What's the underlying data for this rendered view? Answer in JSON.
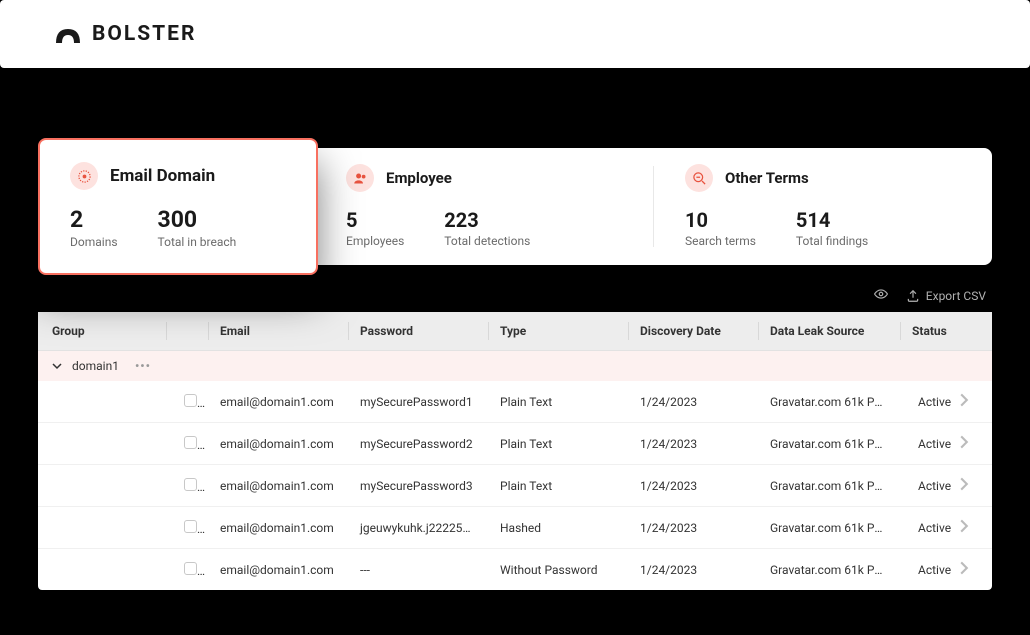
{
  "brand": {
    "name": "BOLSTER"
  },
  "cards": {
    "email_domain": {
      "title": "Email Domain",
      "stat1_value": "2",
      "stat1_label": "Domains",
      "stat2_value": "300",
      "stat2_label": "Total in breach"
    },
    "employee": {
      "title": "Employee",
      "stat1_value": "5",
      "stat1_label": "Employees",
      "stat2_value": "223",
      "stat2_label": "Total detections"
    },
    "other_terms": {
      "title": "Other Terms",
      "stat1_value": "10",
      "stat1_label": "Search terms",
      "stat2_value": "514",
      "stat2_label": "Total findings"
    }
  },
  "toolbar": {
    "export_label": "Export CSV"
  },
  "table": {
    "headers": {
      "group": "Group",
      "email": "Email",
      "password": "Password",
      "type": "Type",
      "discovery_date": "Discovery Date",
      "source": "Data Leak Source",
      "status": "Status"
    },
    "group_name": "domain1",
    "rows": [
      {
        "email": "email@domain1.com",
        "password": "mySecurePassword1",
        "type": "Plain Text",
        "date": "1/24/2023",
        "source": "Gravatar.com 61k Peo...",
        "status": "Active"
      },
      {
        "email": "email@domain1.com",
        "password": "mySecurePassword2",
        "type": "Plain Text",
        "date": "1/24/2023",
        "source": "Gravatar.com 61k Peo...",
        "status": "Active"
      },
      {
        "email": "email@domain1.com",
        "password": "mySecurePassword3",
        "type": "Plain Text",
        "date": "1/24/2023",
        "source": "Gravatar.com 61k Peo...",
        "status": "Active"
      },
      {
        "email": "email@domain1.com",
        "password": "jgeuwykuhk.j222258...",
        "type": "Hashed",
        "date": "1/24/2023",
        "source": "Gravatar.com 61k Peo...",
        "status": "Active"
      },
      {
        "email": "email@domain1.com",
        "password": "---",
        "type": "Without Password",
        "date": "1/24/2023",
        "source": "Gravatar.com 61k Peo...",
        "status": "Active"
      }
    ]
  }
}
